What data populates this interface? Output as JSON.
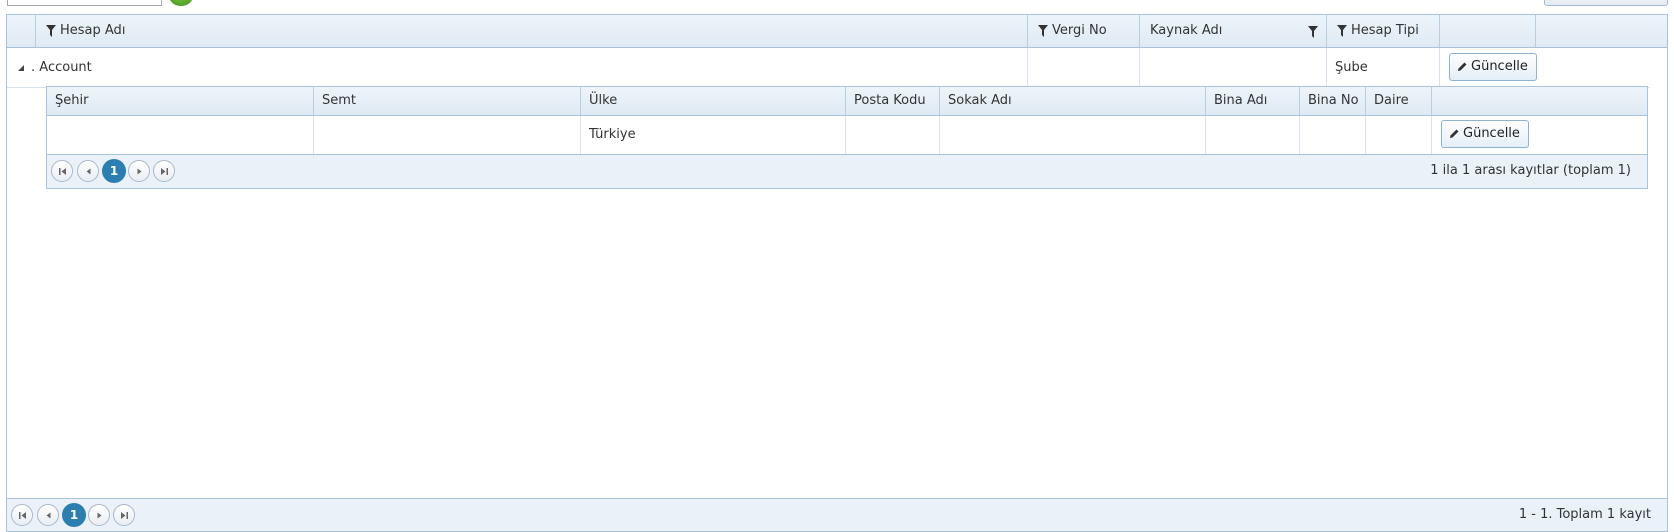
{
  "master": {
    "columns": {
      "account_name": "Hesap Adı",
      "tax_no": "Vergi No",
      "source_name": "Kaynak Adı",
      "account_type": "Hesap Tipi"
    },
    "row": {
      "expand_prefix": ".",
      "account_name": "Account",
      "account_type": "Şube",
      "update_label": "Güncelle"
    },
    "pager": {
      "current_page": "1",
      "info": "1 - 1. Toplam 1 kayıt"
    }
  },
  "detail": {
    "columns": {
      "city": "Şehir",
      "district": "Semt",
      "country": "Ülke",
      "postal_code": "Posta Kodu",
      "street": "Sokak Adı",
      "building_name": "Bina Adı",
      "building_no": "Bina No",
      "apartment": "Daire"
    },
    "row": {
      "country": "Türkiye",
      "update_label": "Güncelle"
    },
    "pager": {
      "current_page": "1",
      "info": "1 ila 1 arası kayıtlar (toplam 1)"
    }
  },
  "icons": {
    "filter": "filter-icon",
    "edit": "pencil-icon",
    "expand": "collapse-triangle-icon",
    "first": "first-page-icon",
    "prev": "prev-page-icon",
    "next": "next-page-icon",
    "last": "last-page-icon"
  },
  "colors": {
    "header_bg": "#dfeaf4",
    "border": "#a9c4d9",
    "pager_active": "#2a7fb0"
  }
}
